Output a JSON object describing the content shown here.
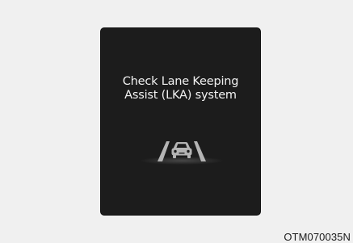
{
  "display": {
    "message_line1": "Check Lane Keeping",
    "message_line2": "Assist (LKA) system",
    "icon": "lka-lane-car-icon"
  },
  "figure_code": "OTM070035N",
  "colors": {
    "page_background": "#f0f0f0",
    "display_background": "#1c1c1c",
    "display_text": "#f2f2f2",
    "icon_gray": "#b4b4b4"
  }
}
